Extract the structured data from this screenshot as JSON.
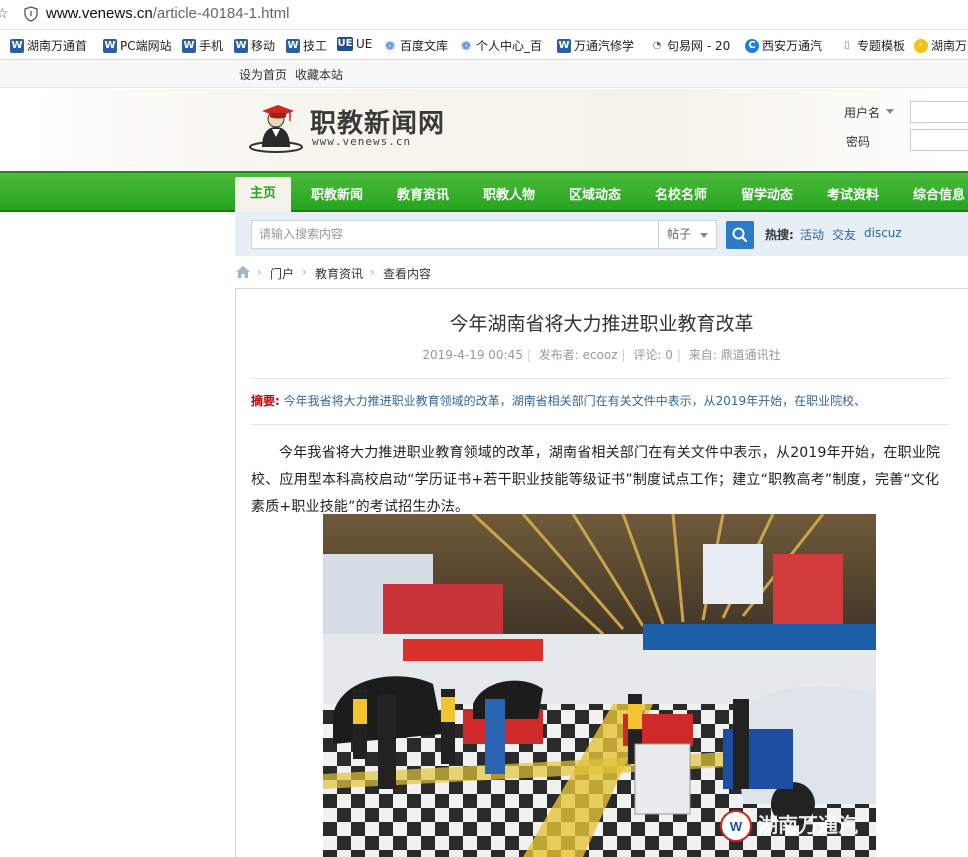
{
  "browser": {
    "url_domain": "www.venews.cn",
    "url_path": "/article-40184-1.html"
  },
  "bookmarks": [
    {
      "label": "湖南万通首",
      "icon": "w-logo-icon"
    },
    {
      "label": "PC端网站",
      "icon": "w-logo-icon"
    },
    {
      "label": "手机",
      "icon": "w-logo-icon"
    },
    {
      "label": "移动",
      "icon": "w-logo-icon"
    },
    {
      "label": "技工",
      "icon": "w-logo-icon"
    },
    {
      "label": "UE",
      "icon": "ue-icon"
    },
    {
      "label": "百度文库",
      "icon": "paw-icon"
    },
    {
      "label": "个人中心_百",
      "icon": "paw-icon"
    },
    {
      "label": "万通汽修学",
      "icon": "w-logo-icon"
    },
    {
      "label": "句易网 - 20",
      "icon": "circle-icon"
    },
    {
      "label": "西安万通汽",
      "icon": "blue-circle-icon"
    },
    {
      "label": "专题模板",
      "icon": "page-icon"
    },
    {
      "label": "湖南万",
      "icon": "yellow-circle-icon"
    }
  ],
  "topbar": {
    "set_home": "设为首页",
    "bookmark_site": "收藏本站"
  },
  "site": {
    "name": "职教新闻网",
    "domain": "www.venews.cn"
  },
  "login": {
    "username_label": "用户名",
    "password_label": "密码"
  },
  "nav": {
    "home": "主页",
    "items": [
      "职教新闻",
      "教育资讯",
      "职教人物",
      "区域动态",
      "名校名师",
      "留学动态",
      "考试资料",
      "综合信息"
    ]
  },
  "search": {
    "placeholder": "请输入搜索内容",
    "type": "帖子",
    "hot_label": "热搜:",
    "hot_links": [
      "活动",
      "交友",
      "discuz"
    ]
  },
  "breadcrumb": [
    "门户",
    "教育资讯",
    "查看内容"
  ],
  "article": {
    "title": "今年湖南省将大力推进职业教育改革",
    "date": "2019-4-19 00:45",
    "publisher": "发布者: ecooz",
    "comments": "评论: 0",
    "source": "来自: 鼎道通讯社",
    "summary_label": "摘要:",
    "summary": "今年我省将大力推进职业教育领域的改革，湖南省相关部门在有关文件中表示，从2019年开始，在职业院校、",
    "body": "今年我省将大力推进职业教育领域的改革，湖南省相关部门在有关文件中表示，从2019年开始，在职业院校、应用型本科高校启动“学历证书+若干职业技能等级证书”制度试点工作；建立“职教高考”制度，完善“文化素质+职业技能”的考试招生办法。",
    "photo_watermark": "湖南万通汽"
  },
  "colors": {
    "nav_green": "#27a41f",
    "link_blue": "#2966a6",
    "summary_red": "#cc0000"
  }
}
